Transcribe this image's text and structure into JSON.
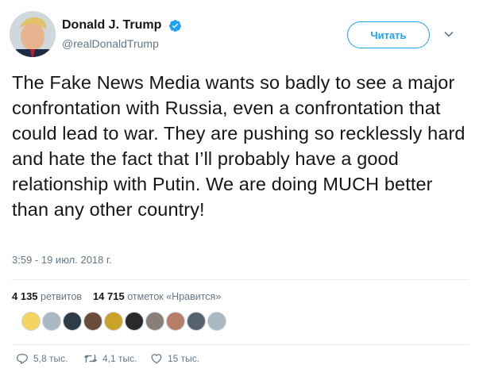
{
  "author": {
    "display_name": "Donald J. Trump",
    "handle": "@realDonaldTrump",
    "verified": true
  },
  "follow_button": {
    "label": "Читать"
  },
  "tweet": {
    "text": "The Fake News Media wants so badly to see a major confrontation with Russia, even a confrontation that could lead to war. They are pushing so recklessly hard and hate the fact that I’ll probably have a good relationship with Putin. We are doing MUCH better than any other country!",
    "timestamp": "3:59 - 19 июл. 2018 г."
  },
  "stats": {
    "retweets_count": "4 135",
    "retweets_label": "ретвитов",
    "likes_count": "14 715",
    "likes_label": "отметок «Нравится»"
  },
  "likers": [
    {
      "name": "liker-1",
      "color": "#f4d35e"
    },
    {
      "name": "liker-2",
      "color": "#aab8c2"
    },
    {
      "name": "liker-3",
      "color": "#2f3b45"
    },
    {
      "name": "liker-4",
      "color": "#6b4c3b"
    },
    {
      "name": "liker-5",
      "color": "#c9a227"
    },
    {
      "name": "liker-6",
      "color": "#2a2a2a"
    },
    {
      "name": "liker-7",
      "color": "#8a7f78"
    },
    {
      "name": "liker-8",
      "color": "#b57f6a"
    },
    {
      "name": "liker-9",
      "color": "#56636e"
    },
    {
      "name": "liker-10",
      "color": "#aab8c2"
    }
  ],
  "actions": {
    "replies": "5,8 тыс.",
    "retweets": "4,1 тыс.",
    "likes": "15 тыс."
  },
  "colors": {
    "accent": "#1da1f2",
    "muted": "#657786",
    "divider": "#e6ecf0"
  }
}
